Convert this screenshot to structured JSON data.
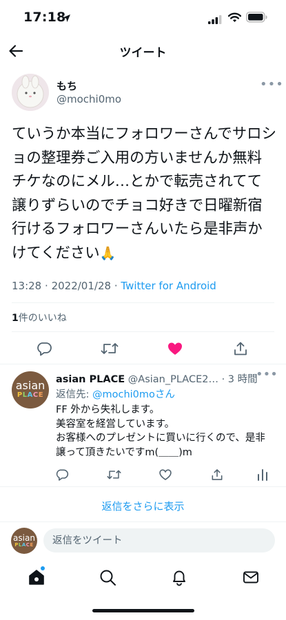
{
  "status_bar": {
    "time": "17:18",
    "icons": [
      "location-arrow-icon",
      "cellular-signal-icon",
      "wifi-icon",
      "battery-icon"
    ]
  },
  "header": {
    "back_icon": "back-arrow-icon",
    "title": "ツイート"
  },
  "tweet": {
    "author_name": "もち",
    "author_handle": "@mochi0mo",
    "avatar": "white-rabbit-doll-avatar",
    "more_icon": "more-icon",
    "text": "ていうか本当にフォロワーさんでサロショの整理券ご入用の方いませんか無料チケなのにメル…とかで転売されてて譲りずらいのでチョコ好きで日曜新宿行けるフォロワーさんいたら是非声かけてください",
    "emoji": "🙏",
    "time": "13:28",
    "date": "2022/01/28",
    "separator": "·",
    "source": "Twitter for Android",
    "likes_count": "1",
    "likes_label": "件のいいね",
    "actions": [
      {
        "name": "reply",
        "icon": "reply-icon"
      },
      {
        "name": "retweet",
        "icon": "retweet-icon"
      },
      {
        "name": "like",
        "icon": "heart-icon",
        "liked": true,
        "color": "#f91880"
      },
      {
        "name": "share",
        "icon": "share-icon"
      }
    ]
  },
  "reply": {
    "author_name": "asian PLACE",
    "author_handle": "@Asian_PLACE2…",
    "separator": "·",
    "time": "3 時間",
    "replying_to_label": "返信先: ",
    "replying_to": "@mochi0moさん",
    "avatar_text_top": "asian",
    "avatar_text_bottom": "PLACE",
    "lines": [
      "FF 外から失礼します。",
      "美容室を経営しています。",
      "お客様へのプレゼントに買いに行くので、是非",
      "譲って頂きたいですm(＿＿)m"
    ],
    "actions": [
      "reply-icon",
      "retweet-icon",
      "heart-icon",
      "share-icon",
      "analytics-icon"
    ]
  },
  "show_more_replies": "返信をさらに表示",
  "composer": {
    "placeholder": "返信をツイート"
  },
  "tabbar": [
    "home-icon",
    "search-icon",
    "notifications-icon",
    "messages-icon"
  ],
  "colors": {
    "accent": "#1d9bf0",
    "like": "#f91880",
    "secondary_text": "#536471",
    "avatar_brown": "#7b5a3f"
  }
}
